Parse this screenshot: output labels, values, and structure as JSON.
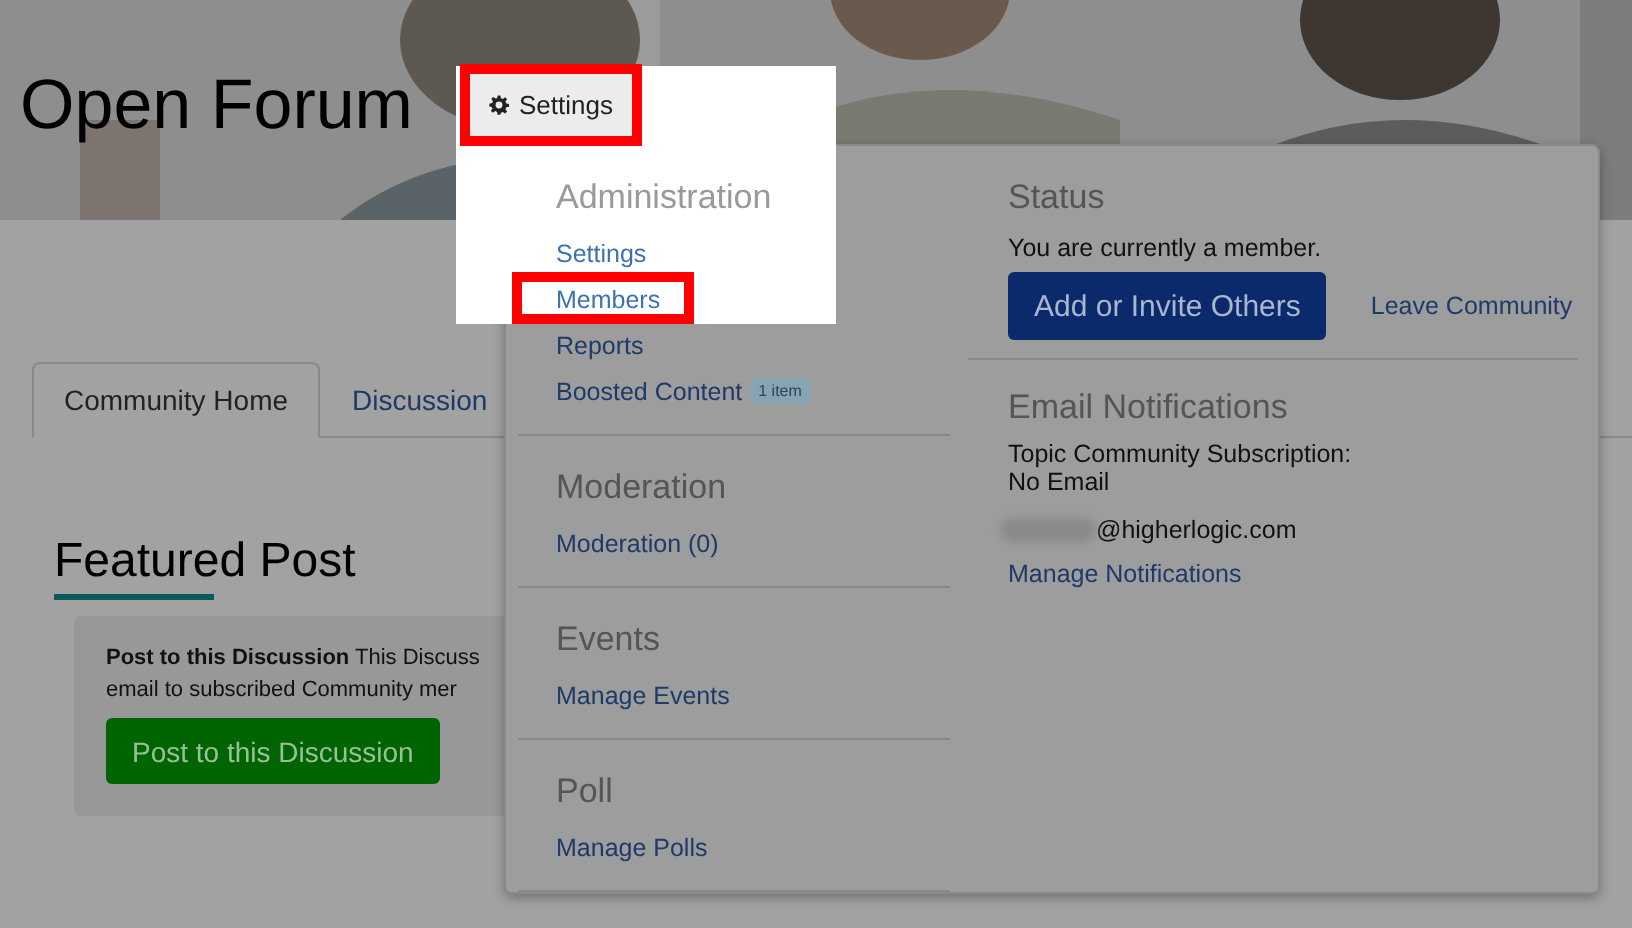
{
  "header": {
    "title": "Open Forum",
    "settings_button": "Settings"
  },
  "tabs": [
    {
      "label": "Community Home",
      "selected": true
    },
    {
      "label": "Discussion",
      "selected": false
    }
  ],
  "featured": {
    "heading": "Featured Post",
    "text": "**Post to this Discussion** This Discuss",
    "text_line2": "email to subscribed Community mer",
    "button": "Post to this Discussion"
  },
  "menu": {
    "sections": [
      {
        "heading": "Administration",
        "highlighted": true,
        "items": [
          {
            "label": "Settings",
            "highlighted": true
          },
          {
            "label": "Members",
            "highlighted": true,
            "annotated": true
          },
          {
            "label": "Reports",
            "highlighted": false
          },
          {
            "label": "Boosted Content",
            "badge": "1 item",
            "highlighted": false
          }
        ]
      },
      {
        "heading": "Moderation",
        "highlighted": false,
        "items": [
          {
            "label": "Moderation (0)",
            "highlighted": false
          }
        ]
      },
      {
        "heading": "Events",
        "highlighted": false,
        "items": [
          {
            "label": "Manage Events",
            "highlighted": false
          }
        ]
      },
      {
        "heading": "Poll",
        "highlighted": false,
        "items": [
          {
            "label": "Manage Polls",
            "highlighted": false
          }
        ]
      }
    ],
    "status": {
      "heading": "Status",
      "text": "You are currently a member.",
      "button": "Add or Invite Others",
      "link": "Leave Community"
    },
    "email": {
      "heading": "Email Notifications",
      "subscription": "Topic Community Subscription:",
      "value": "No Email",
      "address": "@higherlogic.com",
      "link": "Manage Notifications"
    }
  }
}
